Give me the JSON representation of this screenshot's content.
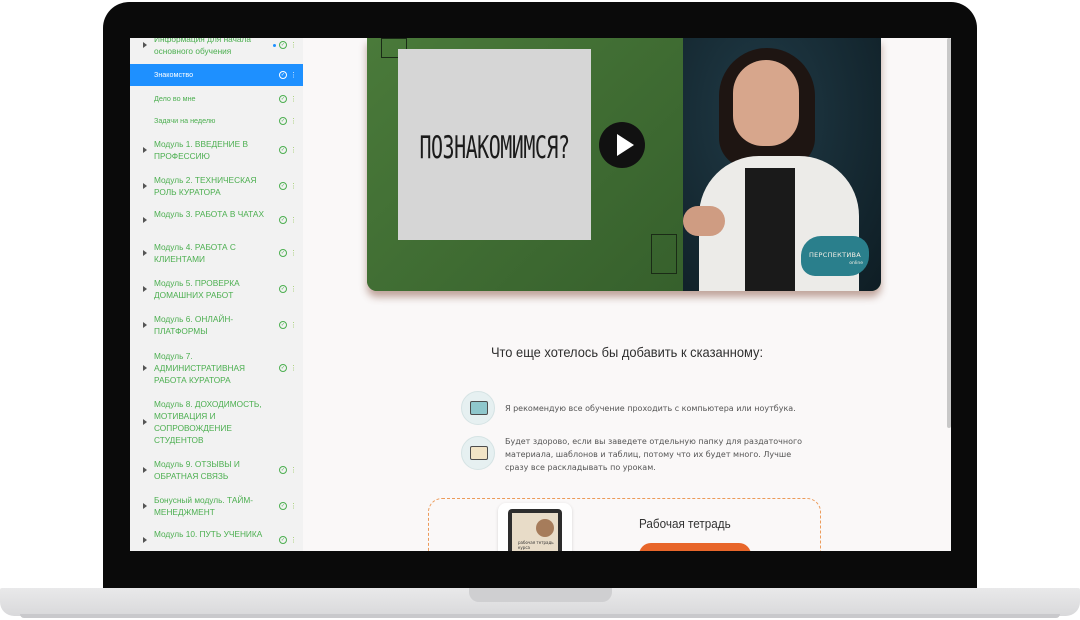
{
  "sidebar": {
    "items": [
      {
        "label": "Информация для начала основного обучения",
        "arrow": true,
        "small": false,
        "active": false
      },
      {
        "label": "Знакомство",
        "arrow": false,
        "small": true,
        "active": true
      },
      {
        "label": "Дело во мне",
        "arrow": false,
        "small": true,
        "active": false
      },
      {
        "label": "Задачи на неделю",
        "arrow": false,
        "small": true,
        "active": false
      },
      {
        "label": "Модуль 1. ВВЕДЕНИЕ В ПРОФЕССИЮ",
        "arrow": true,
        "small": false,
        "active": false
      },
      {
        "label": "Модуль 2. ТЕХНИЧЕСКАЯ РОЛЬ КУРАТОРА",
        "arrow": true,
        "small": false,
        "active": false
      },
      {
        "label": "Модуль 3. РАБОТА В ЧАТАХ",
        "arrow": true,
        "small": false,
        "active": false
      },
      {
        "label": "Модуль 4. РАБОТА С КЛИЕНТАМИ",
        "arrow": true,
        "small": false,
        "active": false
      },
      {
        "label": "Модуль 5. ПРОВЕРКА ДОМАШНИХ РАБОТ",
        "arrow": true,
        "small": false,
        "active": false
      },
      {
        "label": "Модуль 6. ОНЛАЙН-ПЛАТФОРМЫ",
        "arrow": true,
        "small": false,
        "active": false
      },
      {
        "label": "Модуль 7. АДМИНИСТРАТИВНАЯ РАБОТА КУРАТОРА",
        "arrow": true,
        "small": false,
        "active": false
      },
      {
        "label": "Модуль 8. ДОХОДИМОСТЬ, МОТИВАЦИЯ И СОПРОВОЖДЕНИЕ СТУДЕНТОВ",
        "arrow": true,
        "small": false,
        "active": false
      },
      {
        "label": "Модуль 9. ОТЗЫВЫ И ОБРАТНАЯ СВЯЗЬ",
        "arrow": true,
        "small": false,
        "active": false
      },
      {
        "label": "Бонусный модуль. ТАЙМ-МЕНЕДЖМЕНТ",
        "arrow": true,
        "small": false,
        "active": false
      },
      {
        "label": "Модуль 10. ПУТЬ УЧЕНИКА",
        "arrow": true,
        "small": false,
        "active": false
      }
    ]
  },
  "video": {
    "paper_text": "ПОЗНАКОМИМСЯ?",
    "brand": "ПЕРСПЕКТИВА",
    "brand_sub": "online"
  },
  "section": {
    "title": "Что еще хотелось бы добавить к сказанному:",
    "tips": [
      {
        "icon": "computer-icon",
        "text": "Я рекомендую все обучение проходить с компьютера или ноутбука."
      },
      {
        "icon": "folder-icon",
        "text": "Будет здорово, если вы заведете отдельную папку для раздаточного материала, шаблонов и таблиц, потому что их будет много. Лучше сразу все раскладывать по урокам."
      }
    ]
  },
  "workbook": {
    "title": "Рабочая тетрадь",
    "cover_label": "рабочая тетрадь курса"
  },
  "colors": {
    "accent": "#1e90ff",
    "completed": "#4caf50",
    "button": "#e8662a",
    "dashed_border": "#ec9b5a"
  }
}
